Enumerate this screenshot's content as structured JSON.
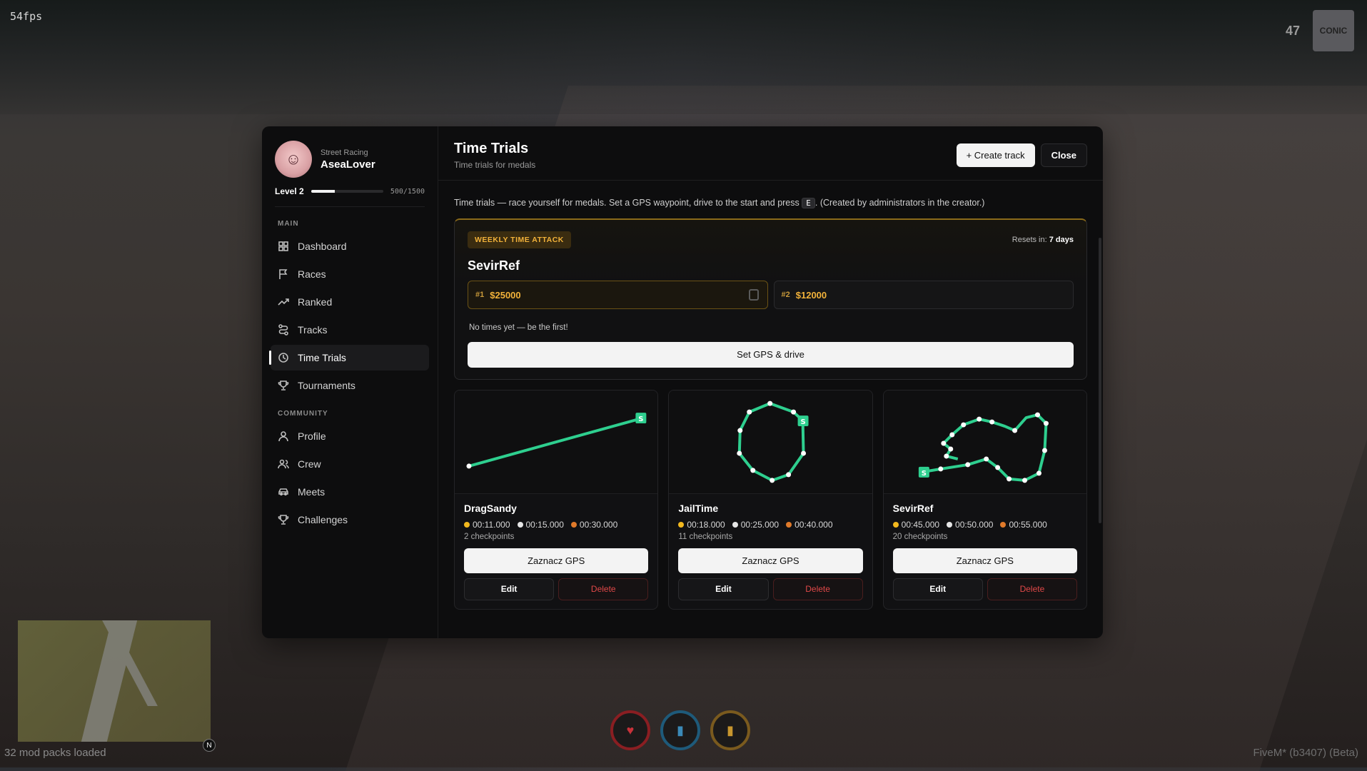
{
  "hud": {
    "fps": "54fps",
    "top_number": "47",
    "logo_text": "CONIC",
    "mods_loaded": "32 mod packs loaded",
    "compass": "N",
    "build": "FiveM* (b3407) (Beta)"
  },
  "sidebar": {
    "subtitle": "Street Racing",
    "username": "AseaLover",
    "level": "Level 2",
    "xp": "500/1500",
    "xp_progress": 0.333,
    "section_main": "MAIN",
    "main_items": [
      {
        "label": "Dashboard",
        "icon": "dashboard-icon"
      },
      {
        "label": "Races",
        "icon": "flag-icon"
      },
      {
        "label": "Ranked",
        "icon": "trend-icon"
      },
      {
        "label": "Tracks",
        "icon": "route-icon"
      },
      {
        "label": "Time Trials",
        "icon": "clock-icon"
      },
      {
        "label": "Tournaments",
        "icon": "trophy-icon"
      }
    ],
    "section_community": "COMMUNITY",
    "community_items": [
      {
        "label": "Profile",
        "icon": "user-icon"
      },
      {
        "label": "Crew",
        "icon": "users-icon"
      },
      {
        "label": "Meets",
        "icon": "car-icon"
      },
      {
        "label": "Challenges",
        "icon": "trophy-icon"
      }
    ]
  },
  "header": {
    "title": "Time Trials",
    "subtitle": "Time trials for medals",
    "create_label": "+ Create track",
    "close_label": "Close"
  },
  "info": {
    "before_key": "Time trials — race yourself for medals. Set a GPS waypoint, drive to the start and press",
    "key": "E",
    "after_key": ". (Created by administrators in the creator.)"
  },
  "weekly": {
    "badge": "WEEKLY TIME ATTACK",
    "resets_label": "Resets in:",
    "resets_value": "7 days",
    "track": "SevirRef",
    "prizes": [
      {
        "rank": "#1",
        "amount": "$25000"
      },
      {
        "rank": "#2",
        "amount": "$12000"
      }
    ],
    "empty_text": "No times yet — be the first!",
    "action_label": "Set GPS & drive"
  },
  "tracks": [
    {
      "name": "DragSandy",
      "gold": "00:11.000",
      "silver": "00:15.000",
      "bronze": "00:30.000",
      "checkpoints": "2 checkpoints",
      "gps_label": "Zaznacz GPS",
      "edit_label": "Edit",
      "delete_label": "Delete"
    },
    {
      "name": "JailTime",
      "gold": "00:18.000",
      "silver": "00:25.000",
      "bronze": "00:40.000",
      "checkpoints": "11 checkpoints",
      "gps_label": "Zaznacz GPS",
      "edit_label": "Edit",
      "delete_label": "Delete"
    },
    {
      "name": "SevirRef",
      "gold": "00:45.000",
      "silver": "00:50.000",
      "bronze": "00:55.000",
      "checkpoints": "20 checkpoints",
      "gps_label": "Zaznacz GPS",
      "edit_label": "Edit",
      "delete_label": "Delete"
    }
  ],
  "colors": {
    "accent_track": "#2ecf8f",
    "gold": "#f2b81e",
    "silver": "#e6e6e6",
    "bronze": "#e07a2a",
    "danger": "#e04848"
  }
}
